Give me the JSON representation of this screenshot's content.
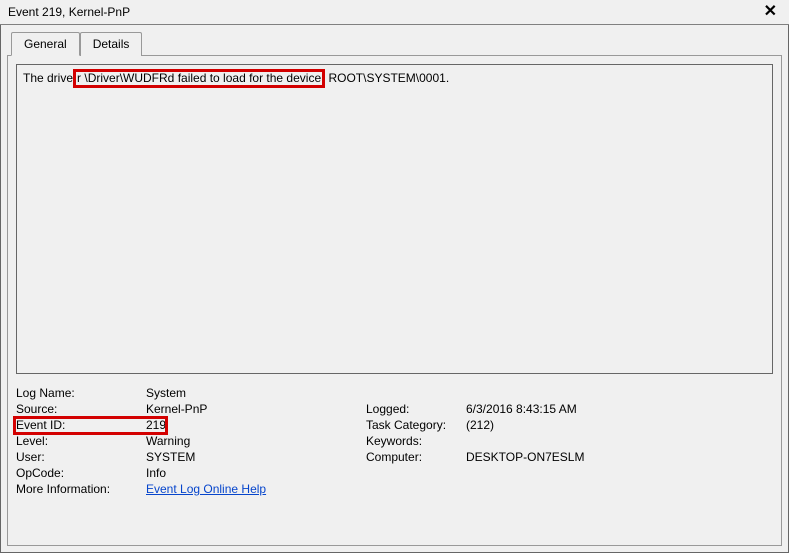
{
  "window": {
    "title": "Event 219, Kernel-PnP"
  },
  "tabs": {
    "general": "General",
    "details": "Details"
  },
  "message": {
    "prefix": "The drive",
    "highlighted": "r \\Driver\\WUDFRd failed to load for the device",
    "suffix": " ROOT\\SYSTEM\\0001."
  },
  "fields": {
    "log_name_label": "Log Name:",
    "log_name_value": "System",
    "source_label": "Source:",
    "source_value": "Kernel-PnP",
    "logged_label": "Logged:",
    "logged_value": "6/3/2016 8:43:15 AM",
    "event_id_label": "Event ID:",
    "event_id_value": "219",
    "task_category_label": "Task Category:",
    "task_category_value": "(212)",
    "level_label": "Level:",
    "level_value": "Warning",
    "keywords_label": "Keywords:",
    "keywords_value": "",
    "user_label": "User:",
    "user_value": "SYSTEM",
    "computer_label": "Computer:",
    "computer_value": "DESKTOP-ON7ESLM",
    "opcode_label": "OpCode:",
    "opcode_value": "Info",
    "more_info_label": "More Information:",
    "more_info_link": "Event Log Online Help"
  }
}
